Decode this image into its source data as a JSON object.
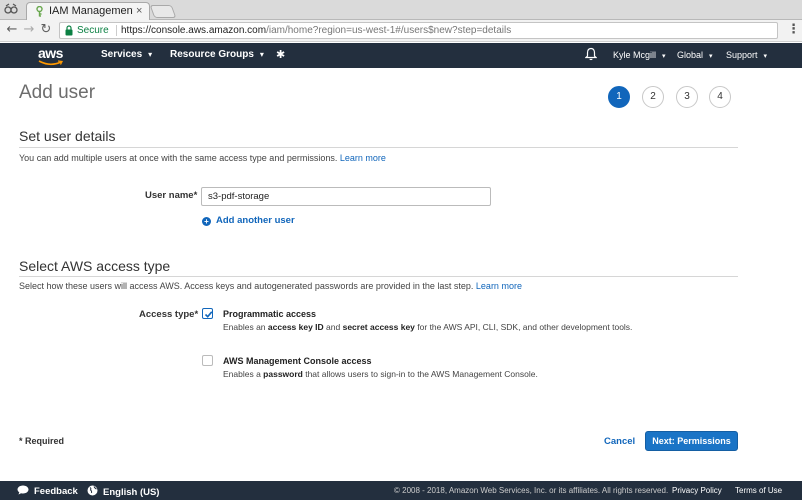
{
  "browser": {
    "tab_title": "IAM Management C",
    "tab_close": "×",
    "back_glyph": "←",
    "forward_glyph": "→",
    "reload_glyph": "↻",
    "secure_label": "Secure",
    "url_scheme_host": "https://console.aws.amazon.com",
    "url_path": "/iam/home?region=us-west-1#/users$new?step=details",
    "star_glyph": "☆",
    "menu_glyph": "⋮"
  },
  "nav": {
    "logo": "aws",
    "services": "Services",
    "resource_groups": "Resource Groups",
    "pin_glyph": "✱",
    "user": "Kyle Mcgill",
    "region": "Global",
    "support": "Support",
    "caret": "▾"
  },
  "page": {
    "title": "Add user",
    "steps": [
      "1",
      "2",
      "3",
      "4"
    ],
    "active_step": "1"
  },
  "details": {
    "title": "Set user details",
    "description": "You can add multiple users at once with the same access type and permissions.",
    "learn_more": "Learn more",
    "user_name_label": "User name*",
    "user_name_value": "s3-pdf-storage",
    "add_another": "Add another user"
  },
  "access": {
    "title": "Select AWS access type",
    "description": "Select how these users will access AWS. Access keys and autogenerated passwords are provided in the last step.",
    "learn_more": "Learn more",
    "label": "Access type*",
    "programmatic": {
      "title": "Programmatic access",
      "checked": true,
      "desc_1": "Enables an ",
      "desc_b1": "access key ID",
      "desc_2": " and ",
      "desc_b2": "secret access key",
      "desc_3": " for the AWS API, CLI, SDK, and other development tools."
    },
    "console": {
      "title": "AWS Management Console access",
      "checked": false,
      "desc_1": "Enables a ",
      "desc_b1": "password",
      "desc_2": " that allows users to sign-in to the AWS Management Console."
    }
  },
  "actions": {
    "required": "* Required",
    "cancel": "Cancel",
    "next": "Next: Permissions"
  },
  "footer": {
    "feedback": "Feedback",
    "language": "English (US)",
    "copyright": "© 2008 - 2018, Amazon Web Services, Inc. or its affiliates. All rights reserved.",
    "privacy": "Privacy Policy",
    "terms": "Terms of Use"
  },
  "colors": {
    "accent": "#1166bb",
    "nav_bg": "#232f3e",
    "secure_green": "#0b8043"
  }
}
